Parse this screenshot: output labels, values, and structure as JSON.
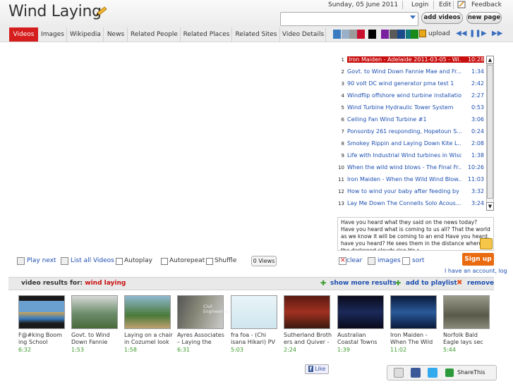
{
  "header": {
    "title": "Wind Laying",
    "date": "Sunday, 05 June 2011",
    "login": "Login",
    "edit": "Edit",
    "feedback": "Feedback",
    "add_videos": "add videos",
    "new_page": "new page",
    "search_value": ""
  },
  "tabs": [
    "Videos",
    "Images",
    "Wikipedia",
    "News",
    "Related People",
    "Related Places",
    "Related Sites",
    "Video Details"
  ],
  "toolbar": {
    "swatches": [
      "#3a7bbf",
      "#9ab0c8",
      "#9b9b9b",
      "#c8102e",
      "#000000",
      "#7a1fa0",
      "#5a5a5a",
      "#1a4a8a",
      "#127a7a",
      "#1a8a1a"
    ],
    "upload": "upload"
  },
  "playlist": [
    {
      "n": "1",
      "title": "Iron Maiden - Adelaide 2011-03-05 - Wi...",
      "dur": "10:28"
    },
    {
      "n": "2",
      "title": "Govt. to Wind Down Fannie Mae and Fr...",
      "dur": "1:34"
    },
    {
      "n": "3",
      "title": "90 volt DC wind generator pma test 1",
      "dur": "2:42"
    },
    {
      "n": "4",
      "title": "Windflip offshore wind turbine installatio...",
      "dur": "2:27"
    },
    {
      "n": "5",
      "title": "Wind Turbine Hydraulic Tower System",
      "dur": "0:53"
    },
    {
      "n": "6",
      "title": "Ceiling Fan Wind Turbine #1",
      "dur": "3:06"
    },
    {
      "n": "7",
      "title": "Ponsonby 261 responding, Hopetoun S...",
      "dur": "0:24"
    },
    {
      "n": "8",
      "title": "Smokey Rippin and Laying Down Kite L...",
      "dur": "2:08"
    },
    {
      "n": "9",
      "title": "Life with Industrial Wind turbines in Wisc...",
      "dur": "1:38"
    },
    {
      "n": "10",
      "title": "When the wild wind blows - The Final Fr...",
      "dur": "10:26"
    },
    {
      "n": "11",
      "title": "Iron Maiden - When the Wild Wind Blow...",
      "dur": "11:03"
    },
    {
      "n": "12",
      "title": "How to wind your baby after feeding by ...",
      "dur": "3:32"
    },
    {
      "n": "13",
      "title": "Lay Me Down The Connells Solo Acous...",
      "dur": "3:24"
    }
  ],
  "lyrics": "Have you heard what they said on the news today? Have you heard what is coming to us all? That the world as we know it will be coming to an end Have you heard, have you heard? He sees them in the distance where the darkened clouds rise He s...",
  "controls": {
    "play_next": "Play next",
    "list_all": "List all Videos",
    "autoplay": "Autoplay",
    "autorepeat": "Autorepeat",
    "shuffle": "Shuffle",
    "views": "0 Views",
    "clear": "clear",
    "images": "images",
    "sort": "sort",
    "signup": "Sign up",
    "have_account": "I have an account, log"
  },
  "results_bar": {
    "label": "video results for:",
    "query": "wind laying",
    "show_more": "show more results",
    "add_playlist": "add to playlist",
    "remove": "remove"
  },
  "results": [
    {
      "title": "F@#king Boom ing School",
      "dur": "6:32"
    },
    {
      "title": "Govt. to Wind Down Fannie",
      "dur": "1:53"
    },
    {
      "title": "Laying on a chair in Cozumel look",
      "dur": "1:58"
    },
    {
      "title": "Ayres Associates – Laying the",
      "dur": "6:31"
    },
    {
      "title": "fra foa -      (Chi isana Hikari) PV",
      "dur": "5:03"
    },
    {
      "title": "Sutherland Broth ers and Quiver -",
      "dur": "2:24"
    },
    {
      "title": "Australian Coastal Towns",
      "dur": "1:39"
    },
    {
      "title": "Iron Maiden - When The Wild",
      "dur": "11:02"
    },
    {
      "title": "Norfolk Bald Eagle lays sec",
      "dur": "5:44"
    }
  ],
  "thumb_text": {
    "engineering": "Civil Engineering"
  },
  "footer": {
    "like": "Like",
    "sharethis": "ShareThis"
  }
}
